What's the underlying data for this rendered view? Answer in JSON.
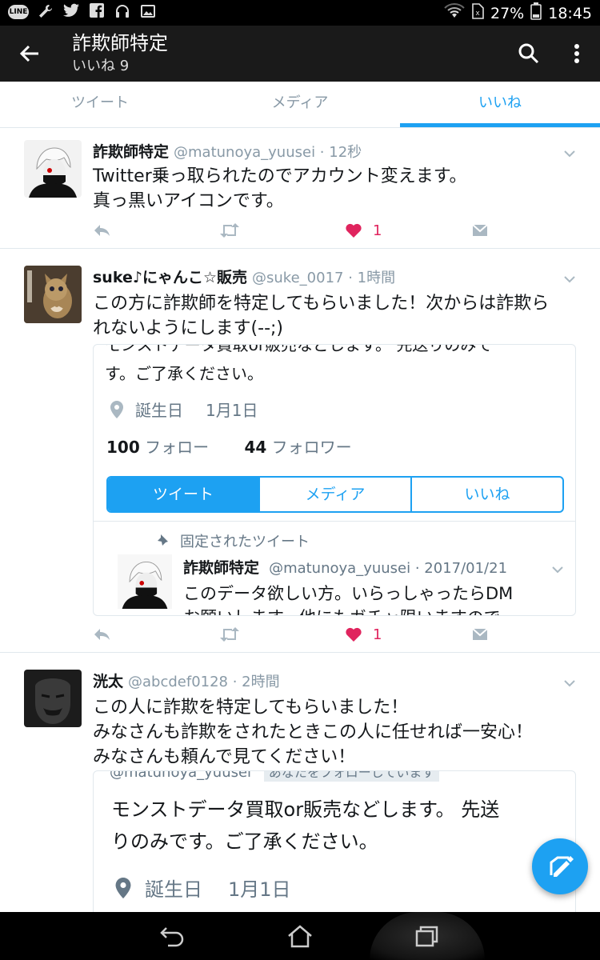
{
  "status": {
    "battery": "27%",
    "time": "18:45",
    "line_badge": "LINE"
  },
  "header": {
    "title": "詐欺師特定",
    "likes_label": "いいね",
    "likes_count": "9"
  },
  "tabs": [
    {
      "label": "ツイート"
    },
    {
      "label": "メディア"
    },
    {
      "label": "いいね"
    }
  ],
  "tweets": [
    {
      "name": "詐欺師特定",
      "meta": "@matunoya_yuusei · 12秒",
      "lines": [
        "Twitter乗っ取られたのでアカウント変えます。",
        "真っ黒いアイコンです。"
      ],
      "like_count": "1"
    },
    {
      "name": "suke♪にゃんこ☆販売",
      "meta": "@suke_0017 · 1時間",
      "lines": [
        "この方に詐欺師を特定してもらいました！次からは詐欺ら",
        "れないようにします(--;)"
      ],
      "like_count": "1",
      "card": {
        "bio_top": "モンストデータ買取or販売などします。 先送りのみで",
        "bio_line": "す。ご了承ください。",
        "birthday_label": "誕生日",
        "birthday_value": "1月1日",
        "following_count": "100",
        "following_label": "フォロー",
        "followers_count": "44",
        "followers_label": "フォロワー",
        "tabs": [
          "ツイート",
          "メディア",
          "いいね"
        ],
        "pinned_label": "固定されたツイート",
        "pinned_name": "詐欺師特定",
        "pinned_meta": "@matunoya_yuusei · 2017/01/21",
        "pinned_line1": "このデータ欲しい方。いらっしゃったらDM",
        "pinned_line2": "お願いします。他にもガチャ限いますので"
      }
    },
    {
      "name": "洸太",
      "meta": "@abcdef0128 · 2時間",
      "lines": [
        "この人に詐欺を特定してもらいました！",
        "みなさんも詐欺をされたときこの人に任せれば一安心！",
        "みなさんも頼んで見てください！"
      ],
      "card": {
        "handle": "@matunoya_yuusei",
        "follows_you": "あなたをフォローしています",
        "bio_line1": "モンストデータ買取or販売などします。 先送",
        "bio_line2": "りのみです。ご了承ください。",
        "birthday_label": "誕生日",
        "birthday_value": "1月1日"
      }
    }
  ],
  "colors": {
    "accent": "#1da1f2",
    "like": "#e0245e",
    "muted": "#8899a6",
    "appbar": "#1a1a1a"
  }
}
